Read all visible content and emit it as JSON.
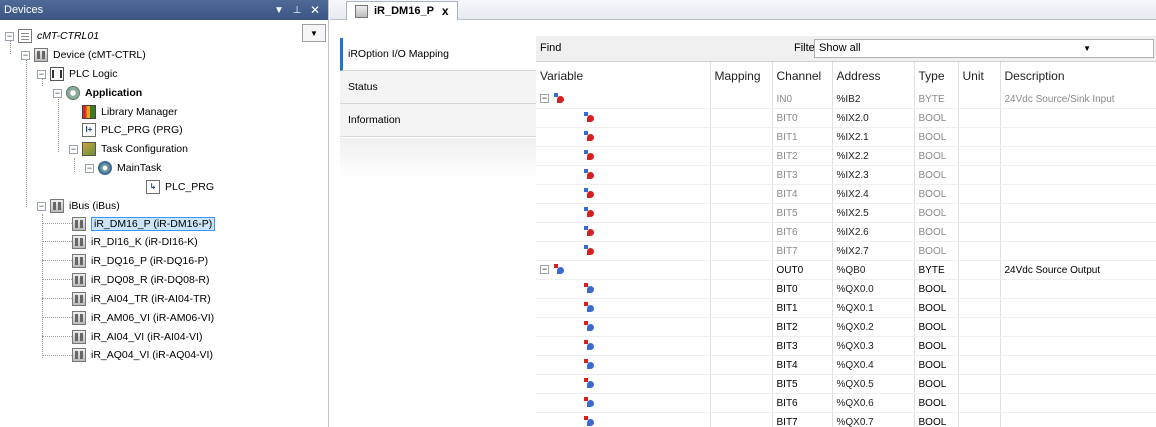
{
  "devices_panel": {
    "title": "Devices",
    "pin_glyph": "▾ ₽",
    "close_glyph": "×",
    "tree": [
      {
        "label": "cMT-CTRL01",
        "icon": "project-icon",
        "style": "italic"
      },
      {
        "label": "Device (cMT-CTRL)",
        "icon": "device-icon"
      },
      {
        "label": "PLC Logic",
        "icon": "plc-logic-icon"
      },
      {
        "label": "Application",
        "icon": "application-icon",
        "style": "bold"
      },
      {
        "label": "Library Manager",
        "icon": "library-manager-icon"
      },
      {
        "label": "PLC_PRG (PRG)",
        "icon": "program-icon"
      },
      {
        "label": "Task Configuration",
        "icon": "task-configuration-icon"
      },
      {
        "label": "MainTask",
        "icon": "main-task-icon"
      },
      {
        "label": "PLC_PRG",
        "icon": "program-call-icon"
      },
      {
        "label": "iBus (iBus)",
        "icon": "bus-icon"
      },
      {
        "label": "iR_DM16_P (iR-DM16-P)",
        "icon": "module-icon",
        "selected": true
      },
      {
        "label": "iR_DI16_K (iR-DI16-K)",
        "icon": "module-icon"
      },
      {
        "label": "iR_DQ16_P (iR-DQ16-P)",
        "icon": "module-icon"
      },
      {
        "label": "iR_DQ08_R (iR-DQ08-R)",
        "icon": "module-icon"
      },
      {
        "label": "iR_AI04_TR (iR-AI04-TR)",
        "icon": "module-icon"
      },
      {
        "label": "iR_AM06_VI (iR-AM06-VI)",
        "icon": "module-icon"
      },
      {
        "label": "iR_AI04_VI (iR-AI04-VI)",
        "icon": "module-icon"
      },
      {
        "label": "iR_AQ04_VI (iR-AQ04-VI)",
        "icon": "module-icon"
      }
    ]
  },
  "editor": {
    "tab_label": "iR_DM16_P",
    "tab_close": "x",
    "subtabs": [
      "iROption I/O Mapping",
      "Status",
      "Information"
    ],
    "find_label": "Find",
    "filter_label": "Filter",
    "filter_value": "Show all",
    "columns": [
      "Variable",
      "Mapping",
      "Channel",
      "Address",
      "Type",
      "Unit",
      "Description"
    ],
    "rows": [
      {
        "kind": "group-in",
        "channel": "IN0",
        "address": "%IB2",
        "type": "BYTE",
        "description": "24Vdc Source/Sink Input"
      },
      {
        "kind": "in",
        "channel": "BIT0",
        "address": "%IX2.0",
        "type": "BOOL",
        "description": ""
      },
      {
        "kind": "in",
        "channel": "BIT1",
        "address": "%IX2.1",
        "type": "BOOL",
        "description": ""
      },
      {
        "kind": "in",
        "channel": "BIT2",
        "address": "%IX2.2",
        "type": "BOOL",
        "description": ""
      },
      {
        "kind": "in",
        "channel": "BIT3",
        "address": "%IX2.3",
        "type": "BOOL",
        "description": ""
      },
      {
        "kind": "in",
        "channel": "BIT4",
        "address": "%IX2.4",
        "type": "BOOL",
        "description": ""
      },
      {
        "kind": "in",
        "channel": "BIT5",
        "address": "%IX2.5",
        "type": "BOOL",
        "description": ""
      },
      {
        "kind": "in",
        "channel": "BIT6",
        "address": "%IX2.6",
        "type": "BOOL",
        "description": ""
      },
      {
        "kind": "in",
        "channel": "BIT7",
        "address": "%IX2.7",
        "type": "BOOL",
        "description": ""
      },
      {
        "kind": "group-out",
        "channel": "OUT0",
        "address": "%QB0",
        "type": "BYTE",
        "description": "24Vdc Source Output"
      },
      {
        "kind": "out",
        "channel": "BIT0",
        "address": "%QX0.0",
        "type": "BOOL",
        "description": ""
      },
      {
        "kind": "out",
        "channel": "BIT1",
        "address": "%QX0.1",
        "type": "BOOL",
        "description": ""
      },
      {
        "kind": "out",
        "channel": "BIT2",
        "address": "%QX0.2",
        "type": "BOOL",
        "description": ""
      },
      {
        "kind": "out",
        "channel": "BIT3",
        "address": "%QX0.3",
        "type": "BOOL",
        "description": ""
      },
      {
        "kind": "out",
        "channel": "BIT4",
        "address": "%QX0.4",
        "type": "BOOL",
        "description": ""
      },
      {
        "kind": "out",
        "channel": "BIT5",
        "address": "%QX0.5",
        "type": "BOOL",
        "description": ""
      },
      {
        "kind": "out",
        "channel": "BIT6",
        "address": "%QX0.6",
        "type": "BOOL",
        "description": ""
      },
      {
        "kind": "out",
        "channel": "BIT7",
        "address": "%QX0.7",
        "type": "BOOL",
        "description": ""
      }
    ]
  }
}
